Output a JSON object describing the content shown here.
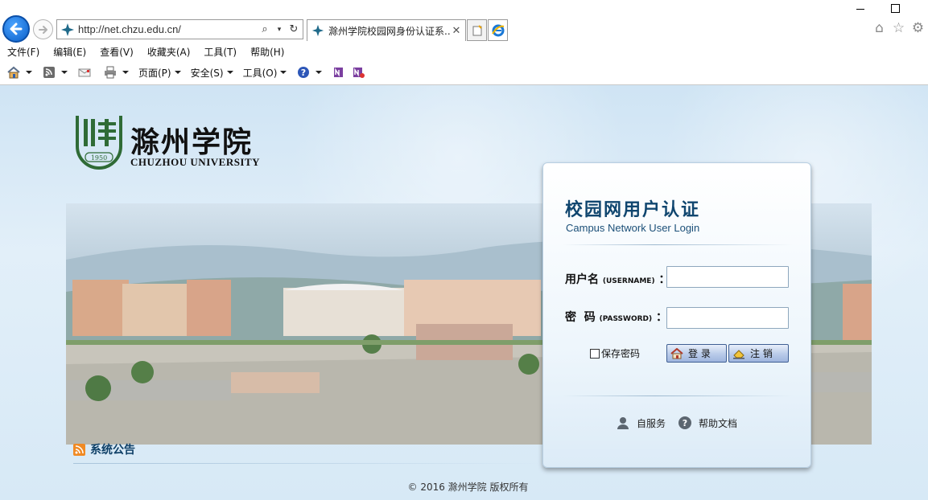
{
  "browser": {
    "url": "http://net.chzu.edu.cn/",
    "tab_title": "滁州学院校园网身份认证系...",
    "tab_close": "✕",
    "menu": [
      "文件(F)",
      "编辑(E)",
      "查看(V)",
      "收藏夹(A)",
      "工具(T)",
      "帮助(H)"
    ],
    "commands": {
      "page": "页面(P)",
      "safety": "安全(S)",
      "tools": "工具(O)"
    }
  },
  "logo": {
    "name_cn": "滁州学院",
    "name_en": "CHUZHOU UNIVERSITY",
    "year": "1950"
  },
  "login": {
    "title": "校园网用户认证",
    "subtitle": "Campus Network User Login",
    "username_label": "用户名",
    "username_en": "(USERNAME)",
    "password_label": "密  码",
    "password_en": "(PASSWORD)",
    "colon": "：",
    "remember_label": "保存密码",
    "login_button": "登 录",
    "logout_button": "注 销",
    "self_service": "自服务",
    "help_doc": "帮助文档"
  },
  "notice": {
    "title": "系统公告"
  },
  "footer": {
    "copyright": "© 2016 滁州学院 版权所有"
  },
  "colors": {
    "accent": "#10466f",
    "page_bg": "#d7e9f6",
    "logo_green": "#2f6b36"
  }
}
